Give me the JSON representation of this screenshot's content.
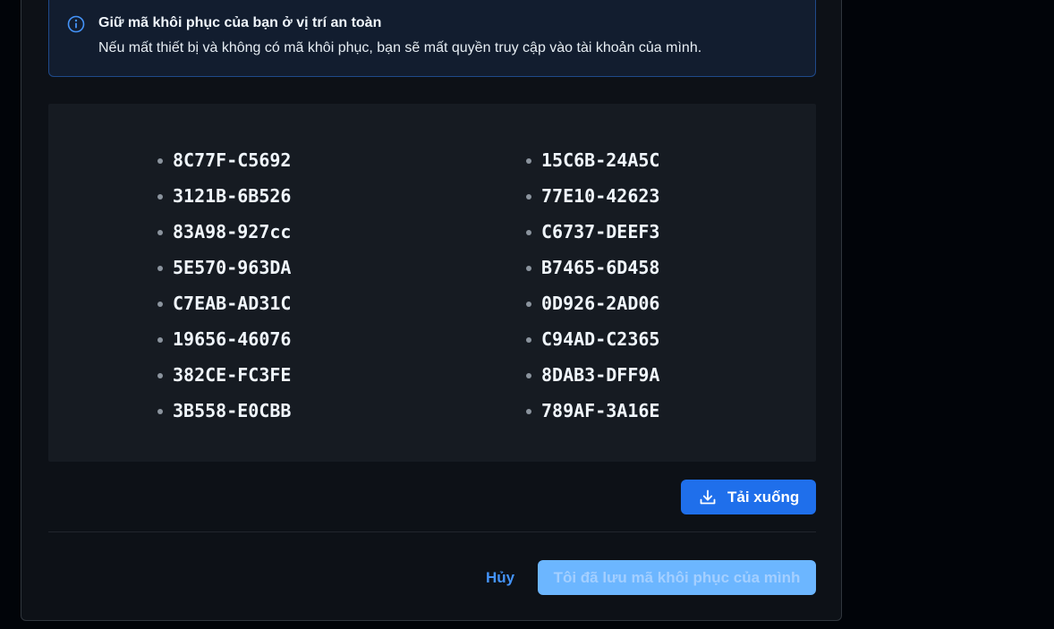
{
  "notice": {
    "icon": "info-icon",
    "title": "Giữ mã khôi phục của bạn ở vị trí an toàn",
    "text": "Nếu mất thiết bị và không có mã khôi phục, bạn sẽ mất quyền truy cập vào tài khoản của mình.",
    "accent_color": "#4493f8"
  },
  "recovery_codes": {
    "left": [
      "8C77F-C5692",
      "3121B-6B526",
      "83A98-927cc",
      "5E570-963DA",
      "C7EAB-AD31C",
      "19656-46076",
      "382CE-FC3FE",
      "3B558-E0CBB"
    ],
    "right": [
      "15C6B-24A5C",
      "77E10-42623",
      "C6737-DEEF3",
      "B7465-6D458",
      "0D926-2AD06",
      "C94AD-C2365",
      "8DAB3-DFF9A",
      "789AF-3A16E"
    ]
  },
  "actions": {
    "download_label": "Tải xuống",
    "download_icon": "download-icon",
    "cancel_label": "Hủy",
    "confirm_label": "Tôi đã lưu mã khôi phục của mình",
    "confirm_disabled": true,
    "primary_color": "#1f6feb"
  }
}
